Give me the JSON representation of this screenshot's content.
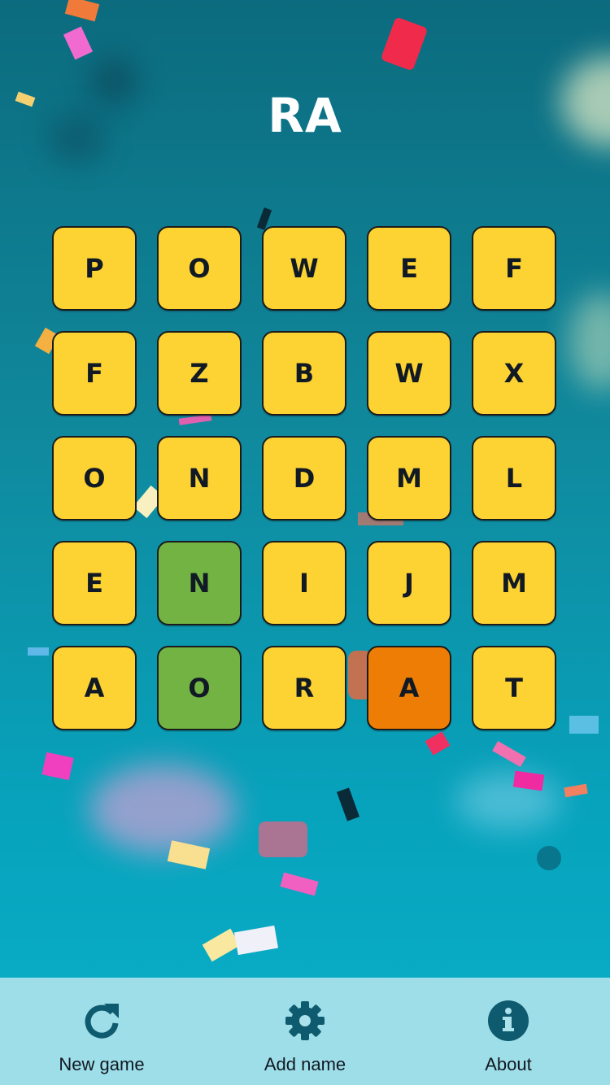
{
  "title": "RA",
  "board": [
    [
      {
        "letter": "P",
        "state": "default"
      },
      {
        "letter": "O",
        "state": "default"
      },
      {
        "letter": "W",
        "state": "default"
      },
      {
        "letter": "E",
        "state": "default"
      },
      {
        "letter": "F",
        "state": "default"
      }
    ],
    [
      {
        "letter": "F",
        "state": "default"
      },
      {
        "letter": "Z",
        "state": "default"
      },
      {
        "letter": "B",
        "state": "default"
      },
      {
        "letter": "W",
        "state": "default"
      },
      {
        "letter": "X",
        "state": "default"
      }
    ],
    [
      {
        "letter": "O",
        "state": "default"
      },
      {
        "letter": "N",
        "state": "default"
      },
      {
        "letter": "D",
        "state": "default"
      },
      {
        "letter": "M",
        "state": "default"
      },
      {
        "letter": "L",
        "state": "default"
      }
    ],
    [
      {
        "letter": "E",
        "state": "default"
      },
      {
        "letter": "N",
        "state": "found"
      },
      {
        "letter": "I",
        "state": "default"
      },
      {
        "letter": "J",
        "state": "default"
      },
      {
        "letter": "M",
        "state": "default"
      }
    ],
    [
      {
        "letter": "A",
        "state": "default"
      },
      {
        "letter": "O",
        "state": "found"
      },
      {
        "letter": "R",
        "state": "default"
      },
      {
        "letter": "A",
        "state": "selected"
      },
      {
        "letter": "T",
        "state": "default"
      }
    ]
  ],
  "tile_colors": {
    "default": "#fdd333",
    "found": "#72b344",
    "selected": "#ee7d05"
  },
  "nav": {
    "new_game": {
      "label": "New game",
      "icon": "refresh-icon"
    },
    "add_name": {
      "label": "Add name",
      "icon": "gear-icon"
    },
    "about": {
      "label": "About",
      "icon": "info-icon"
    }
  },
  "accent_color": "#0e5a6e"
}
